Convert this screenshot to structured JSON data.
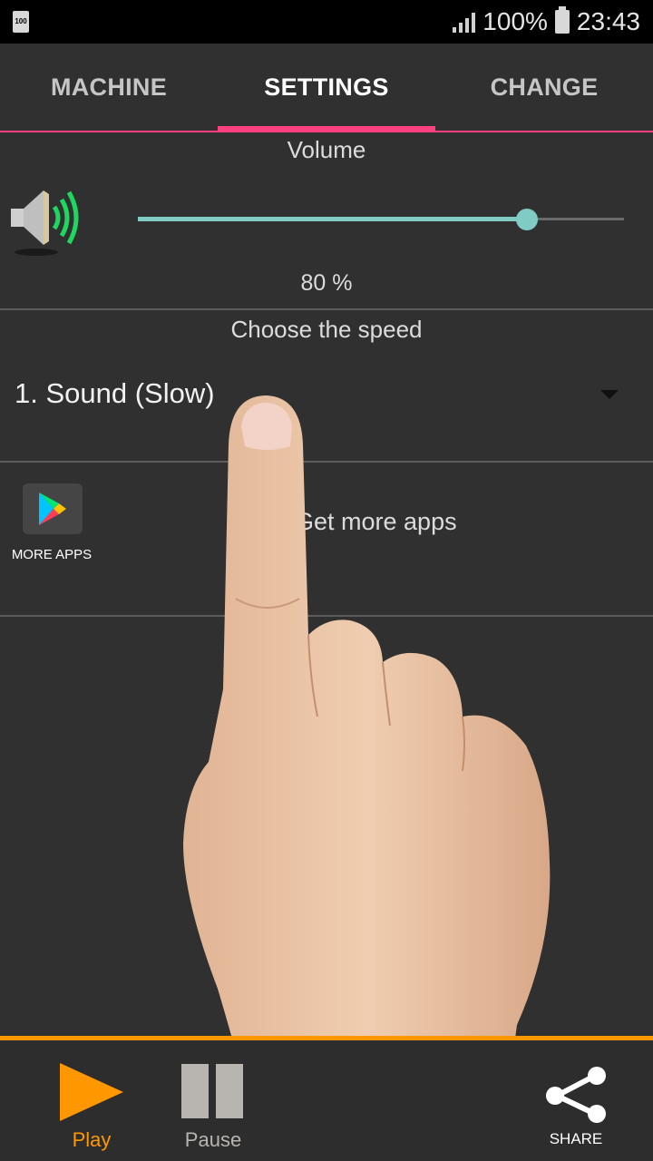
{
  "status_bar": {
    "battery_small": "100",
    "battery_percent": "100%",
    "time": "23:43"
  },
  "tabs": [
    {
      "label": "MACHINE",
      "active": false
    },
    {
      "label": "SETTINGS",
      "active": true
    },
    {
      "label": "CHANGE",
      "active": false
    }
  ],
  "volume": {
    "title": "Volume",
    "level_fraction": 0.8,
    "value_text": "80 %"
  },
  "speed": {
    "title": "Choose the speed",
    "selected": "1. Sound (Slow)"
  },
  "more_apps": {
    "tile_label": "MORE APPS",
    "link_text": "Get more apps"
  },
  "bottom_bar": {
    "play_label": "Play",
    "pause_label": "Pause",
    "share_label": "SHARE"
  },
  "colors": {
    "accent_tab": "#ff4081",
    "slider": "#80cbc4",
    "orange": "#ff9800"
  },
  "icons": [
    "speaker-icon",
    "google-play-icon",
    "play-icon",
    "pause-icon",
    "share-icon",
    "dropdown-arrow-icon",
    "signal-icon",
    "battery-icon"
  ]
}
